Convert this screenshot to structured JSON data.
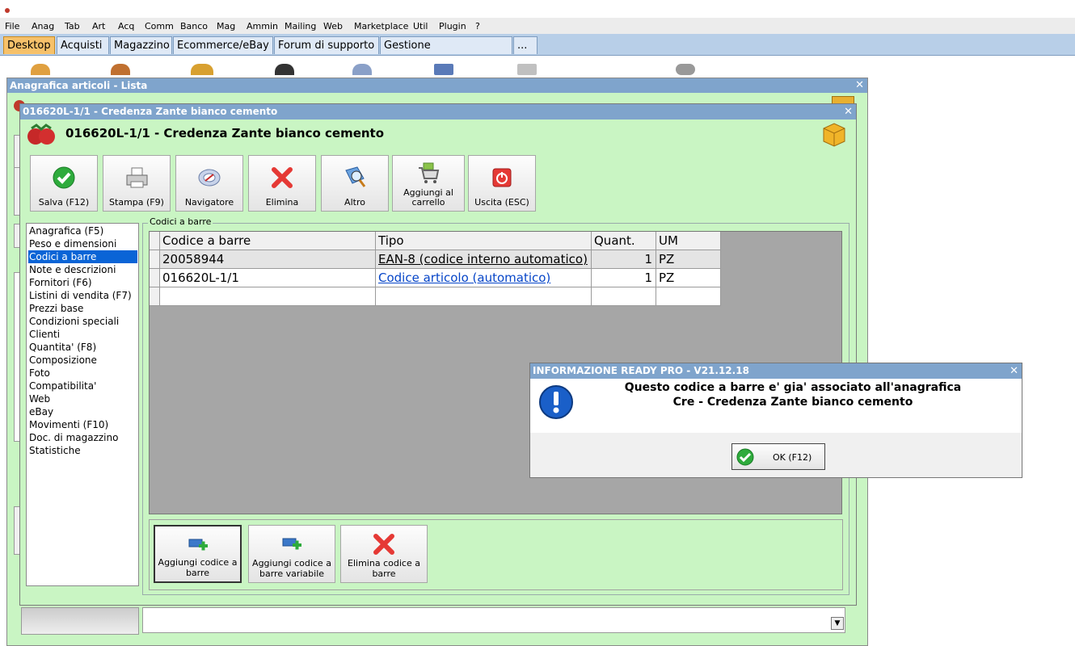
{
  "menubar": {
    "items": [
      "File",
      "Anag",
      "Tab",
      "Art",
      "Acq",
      "Comm",
      "Banco",
      "Mag",
      "Ammin",
      "Mailing",
      "Web",
      "Marketplace",
      "Util",
      "Plugin",
      "?"
    ]
  },
  "tabs": [
    "Desktop",
    "Acquisti",
    "Magazzino",
    "Ecommerce/eBay",
    "Forum di supporto",
    "Gestione messaggistica",
    "..."
  ],
  "back_window": {
    "title": "Anagrafica articoli  - Lista"
  },
  "front_window": {
    "title": "016620L-1/1 - Credenza Zante bianco cemento",
    "header": "016620L-1/1 - Credenza Zante bianco cemento",
    "toolbar": [
      {
        "label": "Salva (F12)",
        "icon": "check-icon"
      },
      {
        "label": "Stampa (F9)",
        "icon": "printer-icon"
      },
      {
        "label": "Navigatore",
        "icon": "compass-icon"
      },
      {
        "label": "Elimina",
        "icon": "delete-x-icon"
      },
      {
        "label": "Altro",
        "icon": "magnifier-icon"
      },
      {
        "label": "Aggiungi al carrello",
        "icon": "cart-icon"
      },
      {
        "label": "Uscita (ESC)",
        "icon": "power-icon"
      }
    ],
    "nav": [
      "Anagrafica (F5)",
      "Peso e dimensioni",
      "Codici a barre",
      "Note e descrizioni",
      "Fornitori (F6)",
      "Listini di vendita (F7)",
      "Prezzi base",
      "Condizioni speciali",
      "Clienti",
      "Quantita' (F8)",
      "Composizione",
      "Foto",
      "Compatibilita'",
      "Web",
      "eBay",
      "Movimenti (F10)",
      "Doc. di magazzino",
      "Statistiche"
    ],
    "nav_selected": "Codici a barre",
    "group_label": "Codici a barre",
    "grid": {
      "columns": [
        "Codice a barre",
        "Tipo",
        "Quant.",
        "UM"
      ],
      "rows": [
        {
          "code": "20058944",
          "tipo": "EAN-8 (codice interno automatico)",
          "quant": "1",
          "um": "PZ"
        },
        {
          "code": "016620L-1/1",
          "tipo": "Codice articolo (automatico)",
          "quant": "1",
          "um": "PZ"
        }
      ]
    },
    "bottom_buttons": [
      {
        "label": "Aggiungi codice a barre",
        "icon": "add-barcode-icon"
      },
      {
        "label": "Aggiungi codice a barre variabile",
        "icon": "add-barcode-variable-icon"
      },
      {
        "label": "Elimina codice a barre",
        "icon": "delete-x-icon"
      }
    ]
  },
  "dialog": {
    "title": "INFORMAZIONE READY PRO - V21.12.18",
    "line1": "Questo codice a barre e' gia' associato all'anagrafica",
    "line2": "Cre - Credenza Zante bianco cemento",
    "ok_label": "OK (F12)"
  },
  "colors": {
    "titlebar": "#7fa4cc",
    "window_bg": "#c9f5c3",
    "selection": "#0a64d6",
    "active_tab": "#f6c16a",
    "link_blue": "#0645c8"
  }
}
